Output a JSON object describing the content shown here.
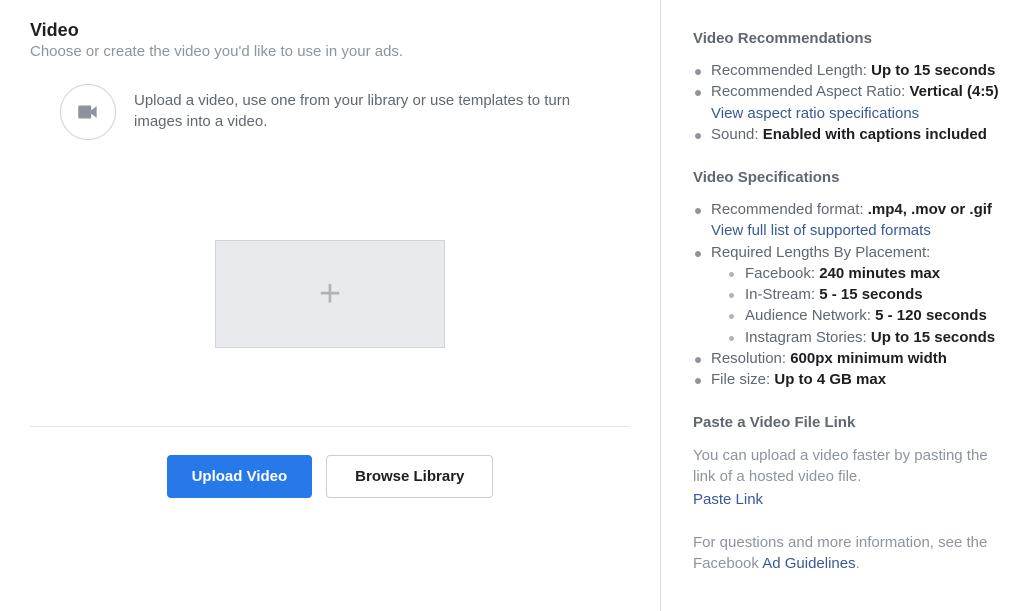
{
  "left": {
    "title": "Video",
    "subtitle": "Choose or create the video you'd like to use in your ads.",
    "upload_desc": "Upload a video, use one from your library or use templates to turn images into a video.",
    "plus": "+",
    "upload_button": "Upload Video",
    "browse_button": "Browse Library"
  },
  "right": {
    "recs_heading": "Video Recommendations",
    "rec_length_label": "Recommended Length: ",
    "rec_length_value": "Up to 15 seconds",
    "rec_ratio_label": "Recommended Aspect Ratio: ",
    "rec_ratio_value": "Vertical (4:5)",
    "aspect_link": "View aspect ratio specifications",
    "sound_label": "Sound: ",
    "sound_value": "Enabled with captions included",
    "specs_heading": "Video Specifications",
    "format_label": "Recommended format: ",
    "format_value": ".mp4, .mov or .gif",
    "formats_link": "View full list of supported formats",
    "lengths_label": "Required Lengths By Placement:",
    "fb_label": "Facebook: ",
    "fb_value": "240 minutes max",
    "instream_label": "In-Stream: ",
    "instream_value": "5 - 15 seconds",
    "audience_label": "Audience Network: ",
    "audience_value": "5 - 120 seconds",
    "ig_label": "Instagram Stories: ",
    "ig_value": "Up to 15 seconds",
    "resolution_label": "Resolution: ",
    "resolution_value": "600px minimum width",
    "filesize_label": "File size: ",
    "filesize_value": "Up to 4 GB max",
    "paste_heading": "Paste a Video File Link",
    "paste_desc": "You can upload a video faster by pasting the link of a hosted video file.",
    "paste_link": "Paste Link",
    "footer_text": "For questions and more information, see the Facebook ",
    "ad_guidelines": "Ad Guidelines",
    "period": "."
  }
}
